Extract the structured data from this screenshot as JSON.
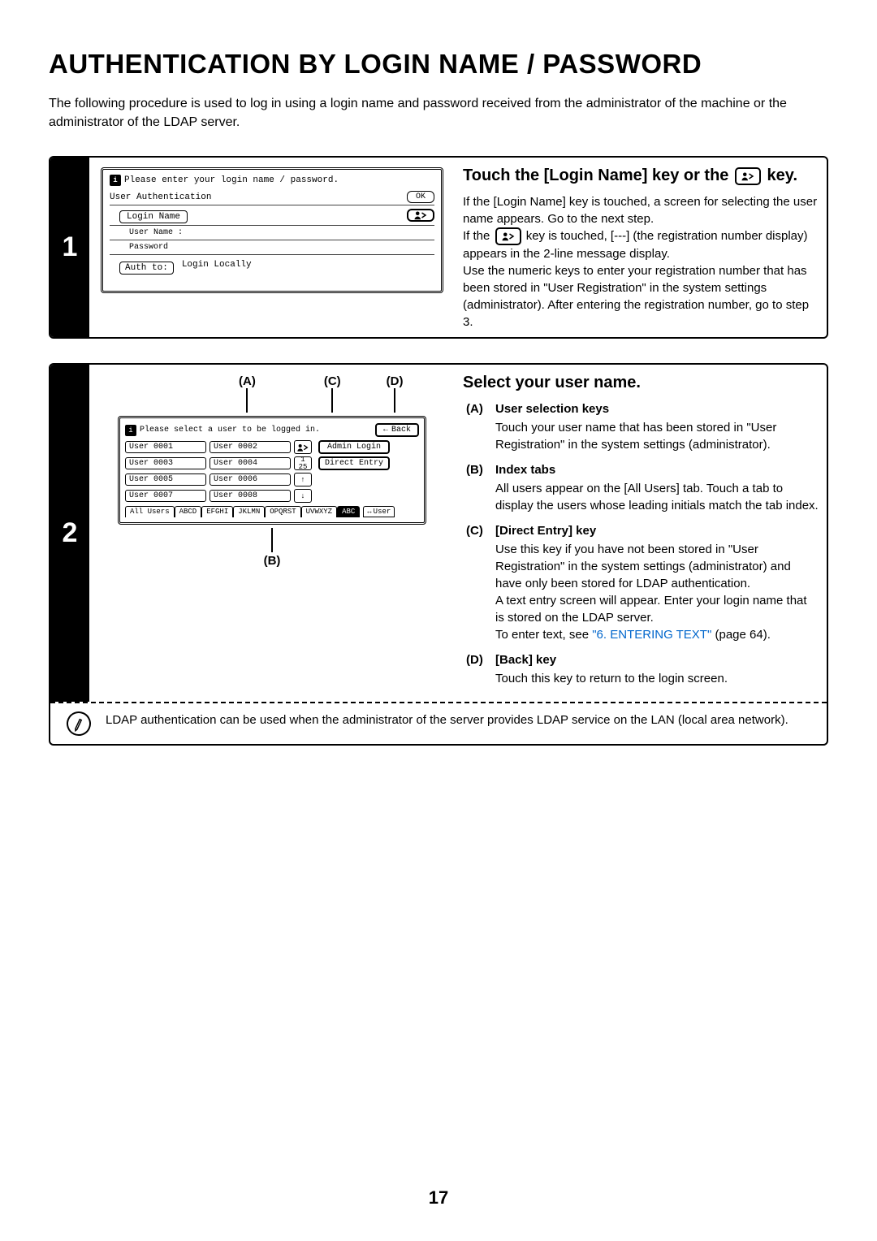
{
  "page": {
    "title": "AUTHENTICATION BY LOGIN NAME / PASSWORD",
    "intro": "The following procedure is used to log in using a login name and password received from the administrator of the machine or the administrator of the LDAP server.",
    "number": "17"
  },
  "step1": {
    "num": "1",
    "panel": {
      "prompt": "Please enter your login name / password.",
      "auth_label": "User Authentication",
      "ok": "OK",
      "login_name": "Login Name",
      "user_name_label": "User Name",
      "user_name_sep": ":",
      "password_label": "Password",
      "auth_to": "Auth to:",
      "auth_target": "Login Locally"
    },
    "heading_a": "Touch the [Login Name] key or the ",
    "heading_b": " key.",
    "body1": "If the [Login Name] key is touched, a screen for selecting the user name appears. Go to the next step.",
    "body2a": "If the ",
    "body2b": " key is touched, [---] (the registration number display) appears in the 2-line message display.",
    "body3": "Use the numeric keys to enter your registration number that has been stored in \"User Registration\" in the system settings (administrator). After entering the registration number, go to step 3."
  },
  "step2": {
    "num": "2",
    "callouts": {
      "a": "(A)",
      "b": "(B)",
      "c": "(C)",
      "d": "(D)"
    },
    "panel": {
      "prompt": "Please select a user to be logged in.",
      "back": "Back",
      "users": [
        "User 0001",
        "User 0002",
        "User 0003",
        "User 0004",
        "User 0005",
        "User 0006",
        "User 0007",
        "User 0008"
      ],
      "page_cur": "1",
      "page_total": "25",
      "admin_login": "Admin Login",
      "direct_entry": "Direct Entry",
      "up": "↑",
      "down": "↓",
      "tabs": [
        "All Users",
        "ABCD",
        "EFGHI",
        "JKLMN",
        "OPQRST",
        "UVWXYZ"
      ],
      "tab_dark": "ABC",
      "user_toggle": "User"
    },
    "heading": "Select your user name.",
    "items": {
      "a_lbl": "(A)",
      "a_hd": "User selection keys",
      "a_tx": "Touch your user name that has been stored in \"User Registration\" in the system settings (administrator).",
      "b_lbl": "(B)",
      "b_hd": "Index tabs",
      "b_tx": "All users appear on the [All Users] tab. Touch a tab to display the users whose leading initials match the tab index.",
      "c_lbl": "(C)",
      "c_hd": "[Direct Entry] key",
      "c_tx1": "Use this key if you have not been stored in \"User Registration\" in the system settings (administrator) and have only been stored for LDAP authentication.",
      "c_tx2": "A text entry screen will appear. Enter your login name that is stored on the LDAP server.",
      "c_tx3a": "To enter text, see ",
      "c_link": "\"6. ENTERING TEXT\"",
      "c_tx3b": " (page 64).",
      "d_lbl": "(D)",
      "d_hd": "[Back] key",
      "d_tx": "Touch this key to return to the login screen."
    },
    "note": "LDAP authentication can be used when the administrator of the server provides LDAP service on the LAN (local area network)."
  }
}
